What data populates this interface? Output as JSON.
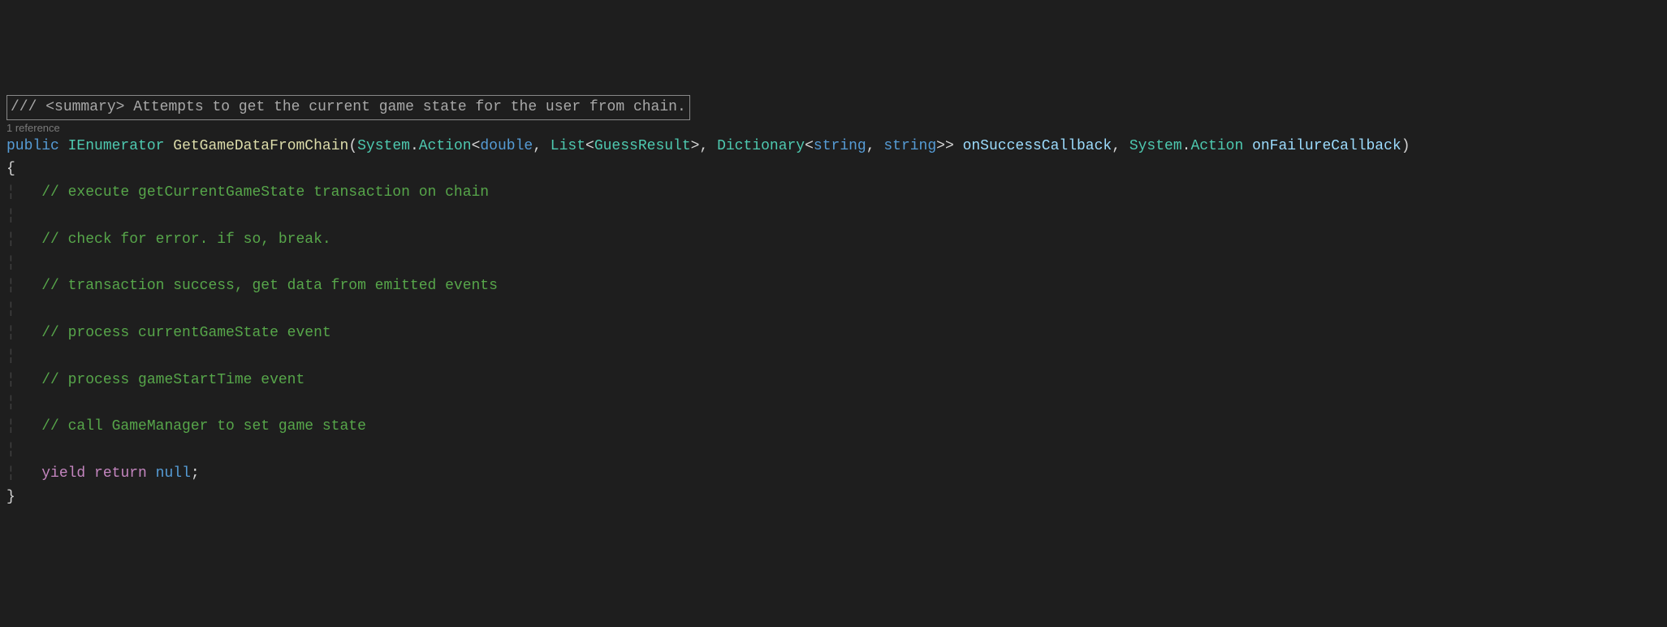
{
  "summary": {
    "prefix": "///",
    "tagOpen": "<summary>",
    "text": " Attempts to get the current game state for the user from chain.",
    "tagClose": ""
  },
  "codelens": "1 reference",
  "sig": {
    "kw_public": "public",
    "type_ienum": "IEnumerator",
    "method": "GetGameDataFromChain",
    "p_open": "(",
    "ns_system": "System",
    "dot": ".",
    "type_action": "Action",
    "angle_open": "<",
    "type_double": "double",
    "comma_sp": ", ",
    "type_list": "List",
    "type_guess": "GuessResult",
    "angle_close": ">",
    "type_dict": "Dictionary",
    "type_string": "string",
    "double_angle_close": ">>",
    "param_success": "onSuccessCallback",
    "param_failure": "onFailureCallback",
    "p_close": ")"
  },
  "body": {
    "brace_open": "{",
    "brace_close": "}",
    "c1": "// execute getCurrentGameState transaction on chain",
    "c2": "// check for error. if so, break.",
    "c3": "// transaction success, get data from emitted events",
    "c4": "// process currentGameState event",
    "c5": "// process gameStartTime event",
    "c6": "// call GameManager to set game state",
    "kw_yield": "yield",
    "kw_return": "return",
    "kw_null": "null",
    "semi": ";"
  }
}
